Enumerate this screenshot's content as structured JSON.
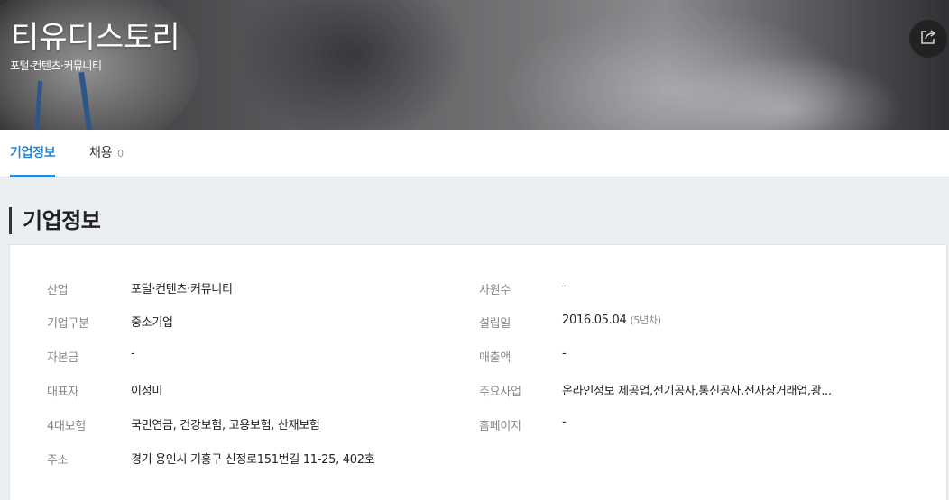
{
  "company": {
    "name": "티유디스토리",
    "industry_tag": "포털·컨텐츠·커뮤니티"
  },
  "share_button": {
    "icon": "share-icon"
  },
  "tabs": [
    {
      "label": "기업정보",
      "active": true
    },
    {
      "label": "채용",
      "count": "0",
      "active": false
    }
  ],
  "section": {
    "title": "기업정보"
  },
  "info": {
    "left": [
      {
        "label": "산업",
        "value": "포털·컨텐츠·커뮤니티"
      },
      {
        "label": "기업구분",
        "value": "중소기업"
      },
      {
        "label": "자본금",
        "value": "-"
      },
      {
        "label": "대표자",
        "value": "이정미"
      },
      {
        "label": "4대보험",
        "value": "국민연금, 건강보험, 고용보험, 산재보험"
      },
      {
        "label": "주소",
        "value": "경기 용인시 기흥구 신정로151번길 11-25, 402호"
      }
    ],
    "right": [
      {
        "label": "사원수",
        "value": "-"
      },
      {
        "label": "설립일",
        "value": "2016.05.04",
        "note": "(5년차)"
      },
      {
        "label": "매출액",
        "value": "-"
      },
      {
        "label": "주요사업",
        "value": "온라인정보 제공업,전기공사,통신공사,전자상거래업,광..."
      },
      {
        "label": "홈페이지",
        "value": "-"
      }
    ]
  },
  "colors": {
    "accent": "#2a87d6",
    "background": "#eceff2"
  }
}
